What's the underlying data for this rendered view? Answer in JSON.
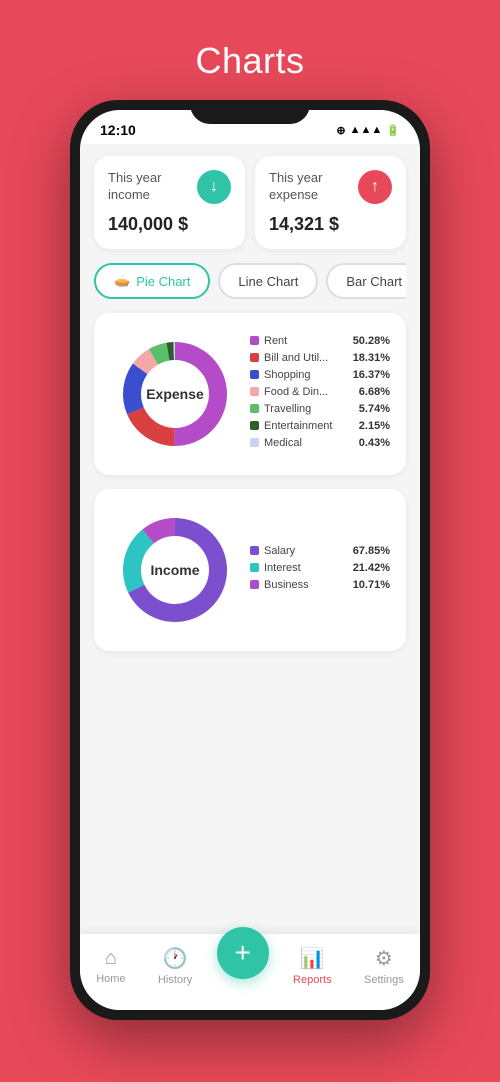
{
  "page": {
    "title": "Charts",
    "bg_color": "#e8495a"
  },
  "status_bar": {
    "time": "12:10",
    "icons": "⊕ ▲ ▲▲ 📶 🔋"
  },
  "income_card": {
    "label": "This year income",
    "amount": "140,000 $",
    "icon": "↓",
    "icon_color": "green"
  },
  "expense_card": {
    "label": "This year expense",
    "amount": "14,321 $",
    "icon": "↑",
    "icon_color": "red"
  },
  "tabs": [
    {
      "label": "Pie Chart",
      "active": true
    },
    {
      "label": "Line Chart",
      "active": false
    },
    {
      "label": "Bar Chart",
      "active": false
    }
  ],
  "expense_chart": {
    "title": "Expense",
    "legend": [
      {
        "name": "Rent",
        "pct": "50.28%",
        "color": "#b44bc8"
      },
      {
        "name": "Bill and Util...",
        "pct": "18.31%",
        "color": "#d94040"
      },
      {
        "name": "Shopping",
        "pct": "16.37%",
        "color": "#3a4ecf"
      },
      {
        "name": "Food & Din...",
        "pct": "6.68%",
        "color": "#f4a7a7"
      },
      {
        "name": "Travelling",
        "pct": "5.74%",
        "color": "#5abf6a"
      },
      {
        "name": "Entertainment",
        "pct": "2.15%",
        "color": "#2a5e2a"
      },
      {
        "name": "Medical",
        "pct": "0.43%",
        "color": "#c8d4f0"
      }
    ],
    "segments": [
      {
        "color": "#b44bc8",
        "pct": 50.28
      },
      {
        "color": "#d94040",
        "pct": 18.31
      },
      {
        "color": "#3a4ecf",
        "pct": 16.37
      },
      {
        "color": "#f4a7a7",
        "pct": 6.68
      },
      {
        "color": "#5abf6a",
        "pct": 5.74
      },
      {
        "color": "#2a5e2a",
        "pct": 2.15
      },
      {
        "color": "#c8d4f0",
        "pct": 0.43
      }
    ]
  },
  "income_chart": {
    "title": "Income",
    "legend": [
      {
        "name": "Salary",
        "pct": "67.85%",
        "color": "#7c4fcf"
      },
      {
        "name": "Interest",
        "pct": "21.42%",
        "color": "#2ec4c4"
      },
      {
        "name": "Business",
        "pct": "10.71%",
        "color": "#b44bc8"
      }
    ],
    "segments": [
      {
        "color": "#7c4fcf",
        "pct": 67.85
      },
      {
        "color": "#2ec4c4",
        "pct": 21.42
      },
      {
        "color": "#b44bc8",
        "pct": 10.71
      }
    ]
  },
  "bottom_nav": [
    {
      "label": "Home",
      "icon": "⌂",
      "active": false
    },
    {
      "label": "History",
      "icon": "🕐",
      "active": false
    },
    {
      "label": "+",
      "icon": "+",
      "is_fab": true
    },
    {
      "label": "Reports",
      "icon": "📊",
      "active": true
    },
    {
      "label": "Settings",
      "icon": "⚙",
      "active": false
    }
  ],
  "gesture_bar": {
    "items": [
      "☰",
      "□",
      "◁"
    ]
  }
}
